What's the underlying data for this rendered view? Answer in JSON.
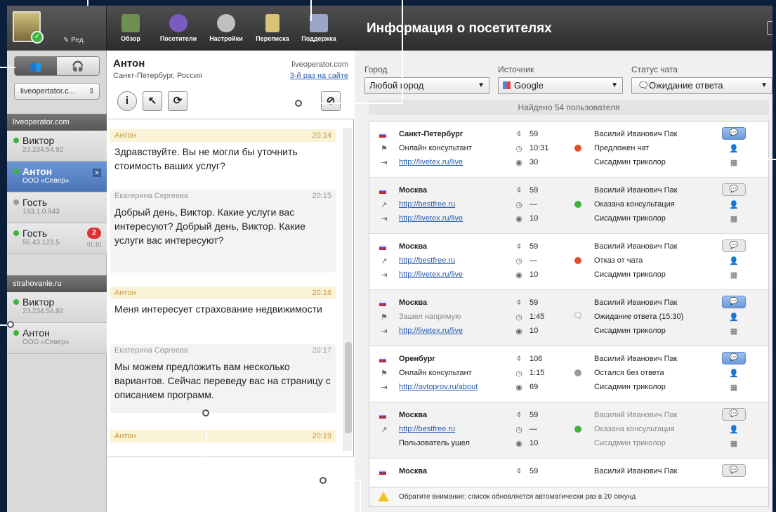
{
  "toolbar": {
    "edit_label": "Ред.",
    "buttons": [
      {
        "label": "Обзор",
        "color": "#6d8f52"
      },
      {
        "label": "Посетители",
        "color": "#7a5bbf"
      },
      {
        "label": "Настройки",
        "color": "#c0c0c0"
      },
      {
        "label": "Переписка",
        "color": "#d8c27a"
      },
      {
        "label": "Поддержка",
        "color": "#9aa6c8"
      }
    ],
    "title": "Информация о посетителях"
  },
  "sidebar": {
    "site_select": "liveopertator.c...",
    "groups": [
      {
        "name": "liveoperator.com"
      },
      {
        "name": "strahovanie.ru"
      }
    ],
    "users": [
      {
        "name": "Виктор",
        "sub": "23.234.54.92"
      },
      {
        "name": "Антон",
        "sub": "ООО «Север»"
      },
      {
        "name": "Гость",
        "sub": "193.1.0.943"
      },
      {
        "name": "Гость",
        "sub": "56.43.123.5",
        "count": "2",
        "time": "01:10"
      },
      {
        "name": "Виктор",
        "sub": "23.234.54.92"
      },
      {
        "name": "Антон",
        "sub": "ООО «Север»"
      }
    ]
  },
  "chat": {
    "name": "Антон",
    "location": "Санкт-Петербург, Россия",
    "site": "liveoperator.com",
    "visit": "3-й раз на сайте",
    "messages": [
      {
        "author": "Антон",
        "time": "20:14",
        "text": "Здравствуйте. Вы не могли бы уточнить стоимость ваших услуг?"
      },
      {
        "author": "Екатерина Сергеева",
        "time": "20:15",
        "text": "Добрый день, Виктор. Какие услуги вас интересуют? Добрый день, Виктор. Какие услуги вас интересуют?"
      },
      {
        "author": "Антон",
        "time": "20:16",
        "text": "Меня интересует страхование недвижимости"
      },
      {
        "author": "Екатерина Сергеева",
        "time": "20:17",
        "text": "Мы можем предложить вам несколько вариантов. Сейчас переведу вас на страницу с описанием программ."
      },
      {
        "author": "Антон",
        "time": "20:19",
        "text": ""
      }
    ]
  },
  "filters": {
    "city_label": "Город",
    "city_value": "Любой город",
    "source_label": "Источник",
    "source_value": "Google",
    "status_label": "Статус чата",
    "status_value": "Ожидание ответа",
    "found": "Найдено 54 пользователя"
  },
  "visitors": [
    {
      "city": "Санкт-Петербург",
      "src": "Онлайн консультант",
      "page": "http://livetex.ru/live",
      "visits": "59",
      "time": "10:31",
      "views": "30",
      "operator": "Василий Иванович Пак",
      "status": "Предложен чат",
      "group": "Сисадмин триколор"
    },
    {
      "city": "Москва",
      "src": "http://bestfree.ru",
      "page": "http://livetex.ru/live",
      "visits": "59",
      "time": "—",
      "views": "10",
      "operator": "Василий Иванович Пак",
      "status": "Оказана консультация",
      "group": "Сисадмин триколор"
    },
    {
      "city": "Москва",
      "src": "http://bestfree.ru",
      "page": "http://livetex.ru/live",
      "visits": "59",
      "time": "—",
      "views": "10",
      "operator": "Василий Иванович Пак",
      "status": "Отказ от чата",
      "group": "Сисадмин триколор"
    },
    {
      "city": "Москва",
      "src": "Зашел напрямую",
      "page": "http://livetex.ru/live",
      "visits": "59",
      "time": "1:45",
      "views": "10",
      "operator": "Василий Иванович Пак",
      "status": "Ожидание ответа (15:30)",
      "group": "Сисадмин триколор"
    },
    {
      "city": "Оренбург",
      "src": "Онлайн консультант",
      "page": "http://avtoprov.ru/about",
      "visits": "106",
      "time": "1:15",
      "views": "69",
      "operator": "Василий Иванович Пак",
      "status": "Остался без ответа",
      "group": "Сисадмин триколор"
    },
    {
      "city": "Москва",
      "src": "http://bestfree.ru",
      "page": "Пользователь ушел",
      "visits": "59",
      "time": "—",
      "views": "10",
      "operator": "Василий Иванович Пак",
      "status": "Оказана консультация",
      "group": "Сисадмин триколор"
    },
    {
      "city": "Москва",
      "src": "",
      "page": "",
      "visits": "59",
      "time": "",
      "views": "",
      "operator": "Василий Иванович Пак",
      "status": "",
      "group": ""
    }
  ],
  "notice": "Обратите внимание: список обновляется автоматически раз в 20 секунд",
  "colors": {
    "online": "#3eb43c",
    "offline": "#9a9a9a",
    "offered": "#e0502a",
    "done": "#3eb43c",
    "refused": "#e0502a",
    "idle": "#999999"
  }
}
